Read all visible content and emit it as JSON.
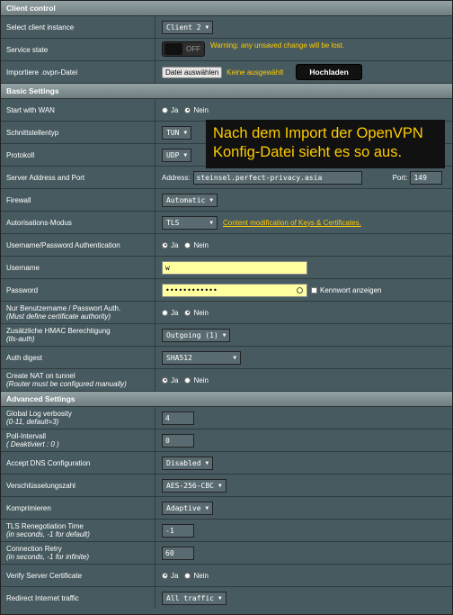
{
  "sections": {
    "client_control": "Client control",
    "basic": "Basic Settings",
    "advanced": "Advanced Settings"
  },
  "client_control": {
    "select_instance_label": "Select client instance",
    "instance_value": "Client 2",
    "service_state_label": "Service state",
    "toggle_text": "OFF",
    "warning": "Warning: any unsaved change will be lost.",
    "import_label": "Importiere .ovpn-Datei",
    "file_button": "Datei auswählen",
    "no_file": "Keine ausgewählt",
    "upload_button": "Hochladen"
  },
  "basic": {
    "start_wan_label": "Start with WAN",
    "yes": "Ja",
    "no": "Nein",
    "interface_label": "Schnittstellentyp",
    "interface_value": "TUN",
    "protocol_label": "Protokoll",
    "protocol_value": "UDP",
    "server_label": "Server Address and Port",
    "address_label": "Address:",
    "address_value": "steinsel.perfect-privacy.asia",
    "port_label": "Port:",
    "port_value": "149",
    "firewall_label": "Firewall",
    "firewall_value": "Automatic",
    "auth_mode_label": "Autorisations-Modus",
    "auth_mode_value": "TLS",
    "keys_link": "Content modification of Keys & Certificates.",
    "userpass_label": "Username/Password Authentication",
    "username_label": "Username",
    "username_value": "w",
    "password_label": "Password",
    "password_value": "••••••••••••",
    "show_password": "Kennwort anzeigen",
    "only_user_label": "Nur Benutzername / Passwort Auth.",
    "only_user_sub": "(Must define certificate authority)",
    "hmac_label": "Zusätzliche HMAC Berechtigung",
    "hmac_sub": "(tls-auth)",
    "hmac_value": "Outgoing (1)",
    "digest_label": "Auth digest",
    "digest_value": "SHA512",
    "nat_label": "Create NAT on tunnel",
    "nat_sub": "(Router must be configured manually)"
  },
  "advanced": {
    "verbosity_label": "Global Log verbosity",
    "verbosity_sub": "(0-11, default=3)",
    "verbosity_value": "4",
    "poll_label": "Poll-Intervall",
    "poll_sub": "( Deaktiviert : 0 )",
    "poll_value": "0",
    "dns_label": "Accept DNS Configuration",
    "dns_value": "Disabled",
    "cipher_label": "Verschlüsselungszahl",
    "cipher_value": "AES-256-CBC",
    "compress_label": "Komprimieren",
    "compress_value": "Adaptive",
    "tls_label": "TLS Renegotiation Time",
    "tls_sub": "(in seconds, -1 for default)",
    "tls_value": "-1",
    "retry_label": "Connection Retry",
    "retry_sub": "(in seconds, -1 for infinite)",
    "retry_value": "60",
    "verify_label": "Verify Server Certificate",
    "redirect_label": "Redirect Internet traffic",
    "redirect_value": "All traffic"
  },
  "callout": {
    "text": "Nach dem Import der OpenVPN Konfig-Datei sieht es so aus."
  }
}
